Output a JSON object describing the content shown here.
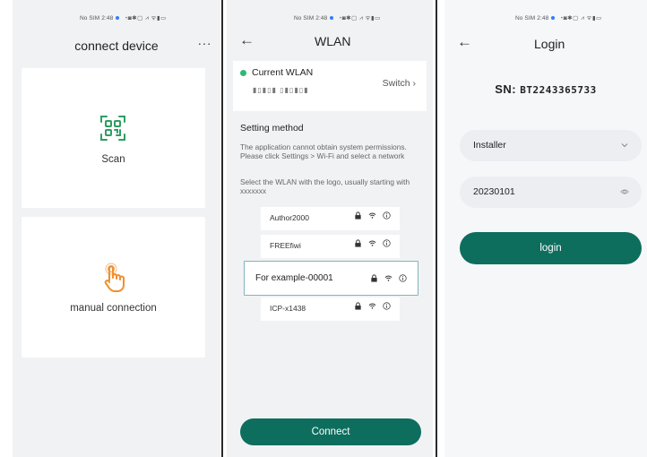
{
  "status_bar": {
    "p1": {
      "carrier": "No SIM",
      "time": "2:48"
    },
    "p2": {
      "carrier": "No SIM",
      "time": "2:48"
    },
    "p3": {
      "carrier": "No SIM",
      "time": "2:48"
    },
    "icons": "◔◙✱▢ ⩘ ᯤ▮▭"
  },
  "screen1": {
    "title": "connect device",
    "more_icon": "more-horizontal-icon",
    "more_label": "···",
    "scan_label": "Scan",
    "scan_icon": "qr-scan-icon",
    "manual_label": "manual connection",
    "manual_icon": "hand-tap-icon",
    "accent": "#2e9e63",
    "hand_color": "#f0902e"
  },
  "screen2": {
    "back_icon": "arrow-left-icon",
    "back_label": "←",
    "title": "WLAN",
    "current_label": "Current WLAN",
    "current_ssid": "▮▯▮▯▮ ▯▮▯▮▯▮",
    "switch_label": "Switch ›",
    "setting_title": "Setting method",
    "setting_text_1": "The application cannot obtain system permissions. Please click Settings > Wi-Fi and select a network",
    "setting_text_2": "Select the WLAN with the logo, usually starting with xxxxxxx",
    "networks": [
      {
        "name": "Author2000"
      },
      {
        "name": "FREEfiwi"
      },
      {
        "name": "For example-00001",
        "selected": true
      },
      {
        "name": "ICP-x1438"
      }
    ],
    "connect_label": "Connect",
    "status_dot_color": "#2eb872",
    "button_color": "#0d6e5e"
  },
  "screen3": {
    "back_icon": "arrow-left-icon",
    "back_label": "←",
    "title": "Login",
    "sn_label": "SN:",
    "sn_value": "BT2243365733",
    "role_value": "Installer",
    "role_icon": "chevron-down-icon",
    "password_value": "20230101",
    "password_icon": "eye-icon",
    "login_label": "login",
    "button_color": "#0d6e5e"
  }
}
